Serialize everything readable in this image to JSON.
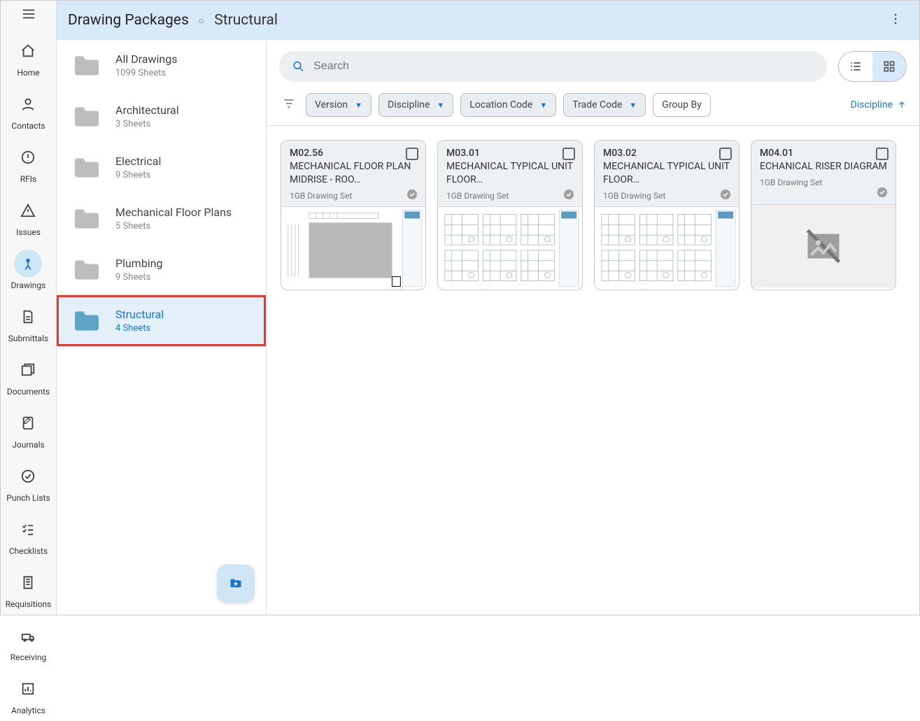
{
  "nav": [
    {
      "key": "home",
      "label": "Home"
    },
    {
      "key": "contacts",
      "label": "Contacts"
    },
    {
      "key": "rfis",
      "label": "RFIs"
    },
    {
      "key": "issues",
      "label": "Issues"
    },
    {
      "key": "drawings",
      "label": "Drawings",
      "active": true
    },
    {
      "key": "submittals",
      "label": "Submittals"
    },
    {
      "key": "documents",
      "label": "Documents"
    },
    {
      "key": "journals",
      "label": "Journals"
    },
    {
      "key": "punchlists",
      "label": "Punch Lists"
    },
    {
      "key": "checklists",
      "label": "Checklists"
    },
    {
      "key": "requisitions",
      "label": "Requisitions"
    },
    {
      "key": "receiving",
      "label": "Receiving"
    },
    {
      "key": "analytics",
      "label": "Analytics"
    }
  ],
  "header": {
    "title": "Drawing Packages",
    "subtitle": "Structural"
  },
  "folders": [
    {
      "name": "All Drawings",
      "count": "1099 Sheets"
    },
    {
      "name": "Architectural",
      "count": "3 Sheets"
    },
    {
      "name": "Electrical",
      "count": "9 Sheets"
    },
    {
      "name": "Mechanical Floor Plans",
      "count": "5 Sheets"
    },
    {
      "name": "Plumbing",
      "count": "9 Sheets"
    },
    {
      "name": "Structural",
      "count": "4 Sheets",
      "selected": true
    }
  ],
  "search": {
    "placeholder": "Search"
  },
  "filters": {
    "chips": [
      {
        "label": "Version",
        "dropdown": true
      },
      {
        "label": "Discipline",
        "dropdown": true
      },
      {
        "label": "Location Code",
        "dropdown": true
      },
      {
        "label": "Trade Code",
        "dropdown": true
      },
      {
        "label": "Group By",
        "dropdown": false
      }
    ],
    "sort": "Discipline"
  },
  "cards": [
    {
      "code": "M02.56",
      "title": "MECHANICAL FLOOR PLAN MIDRISE - ROO…",
      "set": "1GB Drawing Set",
      "thumb": "plan1"
    },
    {
      "code": "M03.01",
      "title": "MECHANICAL TYPICAL UNIT FLOOR…",
      "set": "1GB Drawing Set",
      "thumb": "plan2"
    },
    {
      "code": "M03.02",
      "title": "MECHANICAL TYPICAL UNIT FLOOR…",
      "set": "1GB Drawing Set",
      "thumb": "plan2"
    },
    {
      "code": "M04.01",
      "title": "ECHANICAL RISER DIAGRAM",
      "set": "1GB Drawing Set",
      "thumb": "none"
    }
  ]
}
